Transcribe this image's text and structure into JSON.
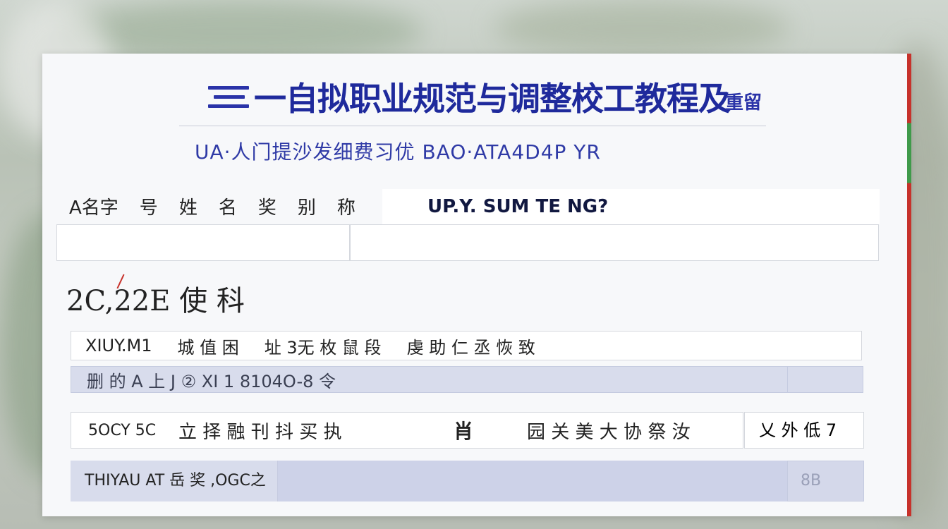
{
  "header": {
    "title": "一自拟职业规范与调整校工教程及",
    "badge": "重留",
    "subtitle": "UA·人门提沙发细费习优 BAO·ATA4D4P YR"
  },
  "form": {
    "labels": [
      "A名字",
      "号",
      "姓",
      "名",
      "奖",
      "别",
      "称"
    ],
    "header": "UP.Y. SUM TE NG?",
    "left_value": "",
    "right_value": ""
  },
  "section": {
    "title": "2C,22E 使 科"
  },
  "rows": {
    "r1": {
      "code": "XIUY.M1",
      "col1": "城 值 困",
      "col2": "址 3无 枚 鼠 段",
      "col3": "虔 助 仁 丞 恢 致"
    },
    "r2": {
      "text": "删 的 A 上 J  ② XI 1 8104O-8 令"
    },
    "r3": {
      "code": "5OCY 5C",
      "col1": "立 择 融 刊 抖 买 执",
      "col2": "肖",
      "col3": "园 关 美 大 协 祭 汝",
      "end": "乂 外 低 7"
    },
    "r4": {
      "label": "THIYAU AT 岳 奖 ,OGC之",
      "value": "8B"
    }
  },
  "colors": {
    "accent": "#1f2a9c",
    "panel": "#f7f8fa",
    "row_tint": "#d8dcec",
    "edge_red": "#c7322b"
  }
}
